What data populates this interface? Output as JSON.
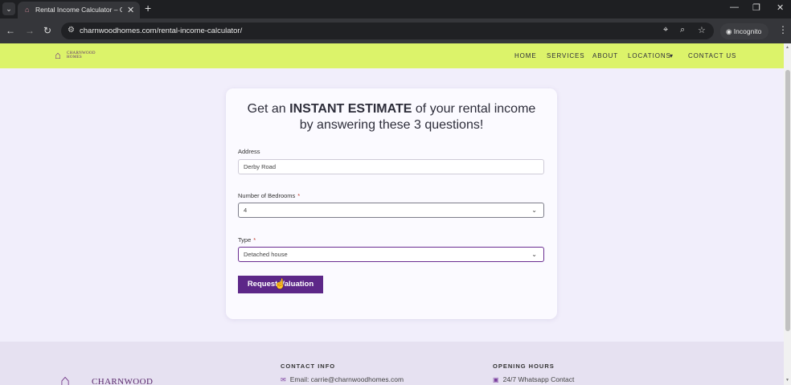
{
  "browser": {
    "tab_title": "Rental Income Calculator – Cha",
    "url": "charnwoodhomes.com/rental-income-calculator/",
    "incognito_label": "Incognito"
  },
  "site": {
    "logo_text": "CHARNWOOD\nHOMES",
    "nav": [
      "HOME",
      "SERVICES",
      "ABOUT",
      "LOCATIONS",
      "CONTACT US"
    ]
  },
  "form": {
    "heading_pre": "Get an ",
    "heading_bold": "INSTANT ESTIMATE",
    "heading_post": " of your rental income by answering these 3 questions!",
    "address_label": "Address",
    "address_value": "Derby Road",
    "bedrooms_label": "Number of Bedrooms",
    "bedrooms_value": "4",
    "type_label": "Type",
    "type_value": "Detached house",
    "required_mark": "*",
    "submit_label": "Request Valuation"
  },
  "footer": {
    "logo_text": "CHARNWOOD",
    "contact_heading": "CONTACT INFO",
    "contact_email": "Email: carrie@charnwoodhomes.com",
    "hours_heading": "OPENING HOURS",
    "hours_line": "24/7 Whatsapp Contact"
  },
  "colors": {
    "header_bg": "#dcf36a",
    "accent": "#5d2788",
    "page_bg": "#f1eefb"
  }
}
